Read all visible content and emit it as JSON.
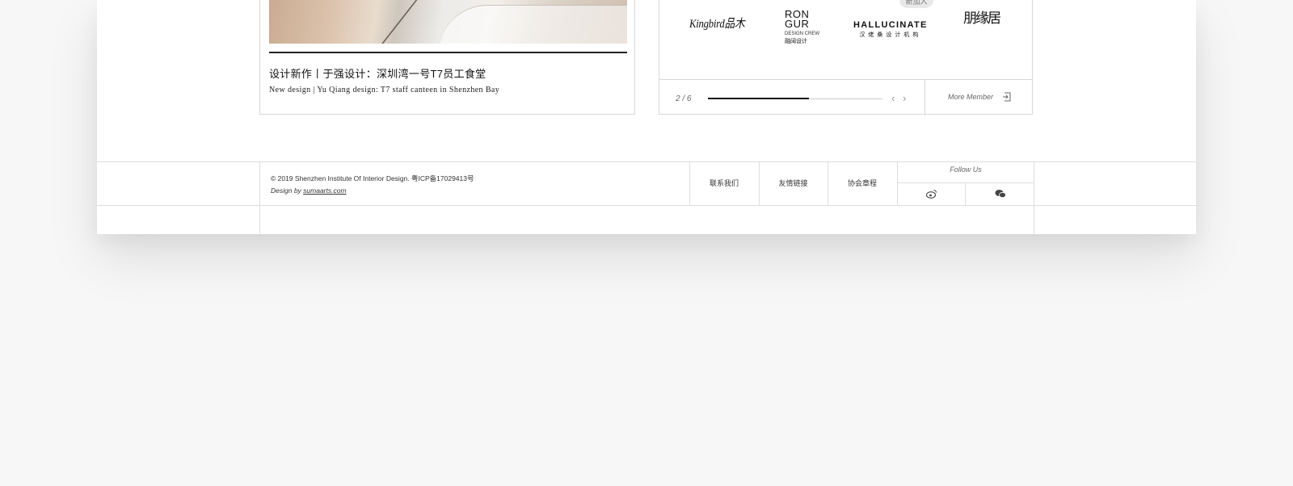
{
  "news": {
    "title_cn": "设计新作丨于强设计：深圳湾一号T7员工食堂",
    "title_en": "New design  |  Yu Qiang design: T7 staff canteen in Shenzhen Bay"
  },
  "members": {
    "badge": "新加入",
    "logos": {
      "kingbird": "Kingbird品木",
      "rongur_big_1": "RON",
      "rongur_big_2": "GUR",
      "rongur_small": "DESIGN CREW",
      "rongur_cn": "融阔设计",
      "hallucinate": "HALLUCINATE",
      "hallucinate_cn": "汉佬桑设计机构",
      "last": "朋缘居"
    },
    "pager": "2 / 6",
    "progress": 0.58,
    "more_label": "More Member"
  },
  "footer": {
    "copyright": "© 2019 Shenzhen Institute Of Interior Design.   粤ICP备17029413号",
    "design_by_prefix": "Design by ",
    "design_by_link": "sumaarts.com",
    "links": [
      "联系我们",
      "友情链接",
      "协会章程"
    ],
    "follow_us": "Follow Us"
  },
  "icons": {
    "weibo": "weibo-icon",
    "wechat": "wechat-icon",
    "more": "exit-arrow-icon"
  }
}
